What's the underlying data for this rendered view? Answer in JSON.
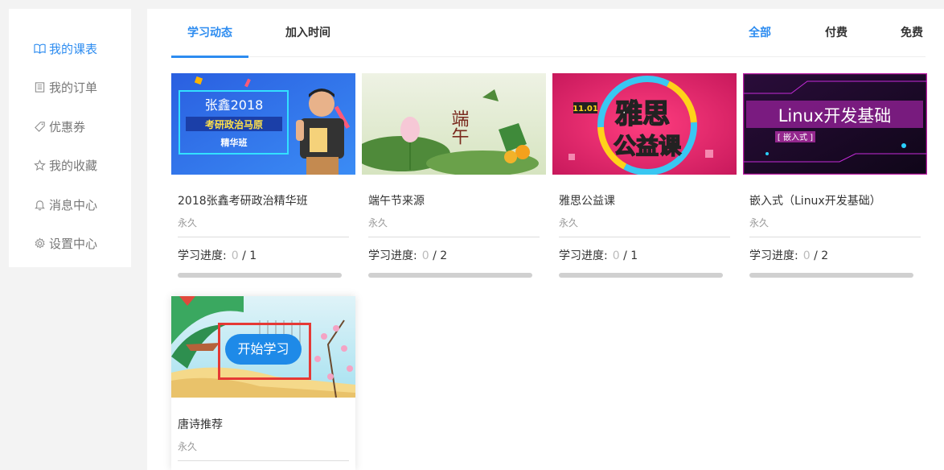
{
  "sidebar": {
    "items": [
      {
        "label": "我的课表",
        "icon": "book-icon"
      },
      {
        "label": "我的订单",
        "icon": "order-icon"
      },
      {
        "label": "优惠券",
        "icon": "tag-icon"
      },
      {
        "label": "我的收藏",
        "icon": "star-icon"
      },
      {
        "label": "消息中心",
        "icon": "bell-icon"
      },
      {
        "label": "设置中心",
        "icon": "gear-icon"
      }
    ]
  },
  "tabs": {
    "study": "学习动态",
    "join": "加入时间"
  },
  "filters": {
    "all": "全部",
    "paid": "付费",
    "free": "免费"
  },
  "progress_label": "学习进度:",
  "colors": {
    "accent": "#2d8cf0",
    "highlight_box": "#e53935"
  },
  "courses": [
    {
      "title": "2018张鑫考研政治精华班",
      "duration": "永久",
      "done": "0",
      "total": "/ 1",
      "progress": 0,
      "thumb": {
        "line1": "张鑫2018",
        "line2": "考研政治马原",
        "line3": "精华班"
      }
    },
    {
      "title": "端午节来源",
      "duration": "永久",
      "done": "0",
      "total": "/ 2",
      "progress": 0,
      "thumb": {
        "text": "端午"
      }
    },
    {
      "title": "雅思公益课",
      "duration": "永久",
      "done": "0",
      "total": "/ 1",
      "progress": 0,
      "thumb": {
        "date": "11.01",
        "text1": "雅思",
        "text2": "公益课"
      }
    },
    {
      "title": "嵌入式（Linux开发基础）",
      "duration": "永久",
      "done": "0",
      "total": "/ 2",
      "progress": 0,
      "thumb": {
        "text": "Linux开发基础",
        "tag": "[ 嵌入式 ]"
      }
    },
    {
      "title": "唐诗推荐",
      "duration": "永久",
      "start_label": "开始学习"
    }
  ]
}
